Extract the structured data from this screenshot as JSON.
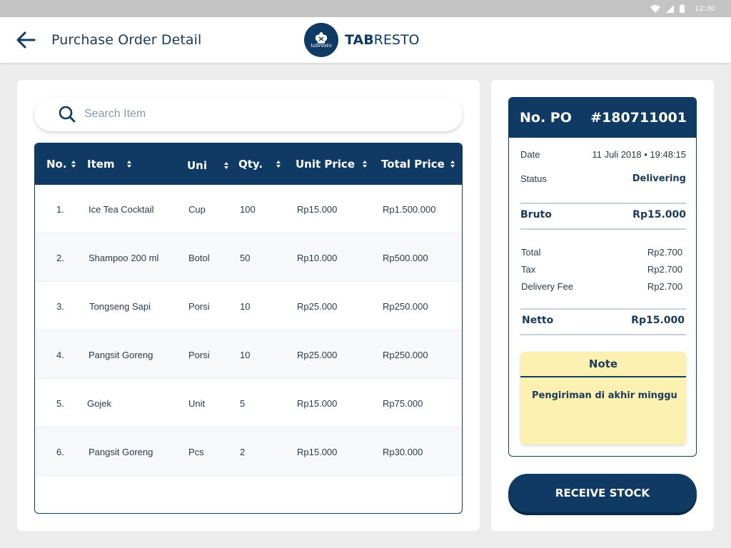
{
  "status_bar": {
    "time": "12:30"
  },
  "app_bar": {
    "title": "Purchase Order Detail",
    "brand_bold": "TAB",
    "brand_rest": "RESTO",
    "logo_subtext": "tabresto"
  },
  "search": {
    "placeholder": "Search Item"
  },
  "table": {
    "headers": [
      "No.",
      "Item",
      "Uni",
      "Qty.",
      "Unit Price",
      "Total Price"
    ],
    "rows": [
      {
        "no": "1.",
        "item": "Ice Tea Cocktail",
        "uni": "Cup",
        "qty": "100",
        "unit_price": "Rp15.000",
        "total_price": "Rp1.500.000"
      },
      {
        "no": "2.",
        "item": "Shampoo 200 ml",
        "uni": "Botol",
        "qty": "50",
        "unit_price": "Rp10.000",
        "total_price": "Rp500.000"
      },
      {
        "no": "3.",
        "item": "Tongseng Sapi",
        "uni": "Porsi",
        "qty": "10",
        "unit_price": "Rp25.000",
        "total_price": "Rp250.000"
      },
      {
        "no": "4.",
        "item": "Pangsit Goreng",
        "uni": "Porsi",
        "qty": "10",
        "unit_price": "Rp25.000",
        "total_price": "Rp250.000"
      },
      {
        "no": "5.",
        "item": "Gojek",
        "uni": "Unit",
        "qty": "5",
        "unit_price": "Rp15.000",
        "total_price": "Rp75.000"
      },
      {
        "no": "6.",
        "item": "Pangsit Goreng",
        "uni": "Pcs",
        "qty": "2",
        "unit_price": "Rp15.000",
        "total_price": "Rp30.000"
      }
    ]
  },
  "po": {
    "label": "No. PO",
    "number": "#180711001",
    "date_label": "Date",
    "date_value": "11 Juli 2018 • 19:48:15",
    "status_label": "Status",
    "status_value": "Delivering",
    "bruto_label": "Bruto",
    "bruto_value": "Rp15.000",
    "total_label": "Total",
    "total_value": "Rp2.700",
    "tax_label": "Tax",
    "tax_value": "Rp2.700",
    "delivery_label": "Delivery Fee",
    "delivery_value": "Rp2.700",
    "netto_label": "Netto",
    "netto_value": "Rp15.000"
  },
  "note": {
    "title": "Note",
    "text": "Pengiriman di akhir minggu"
  },
  "actions": {
    "receive_label": "RECEIVE STOCK"
  },
  "colors": {
    "primary": "#0f3a63",
    "note_bg": "#fdf1b1",
    "background": "#ececec"
  }
}
